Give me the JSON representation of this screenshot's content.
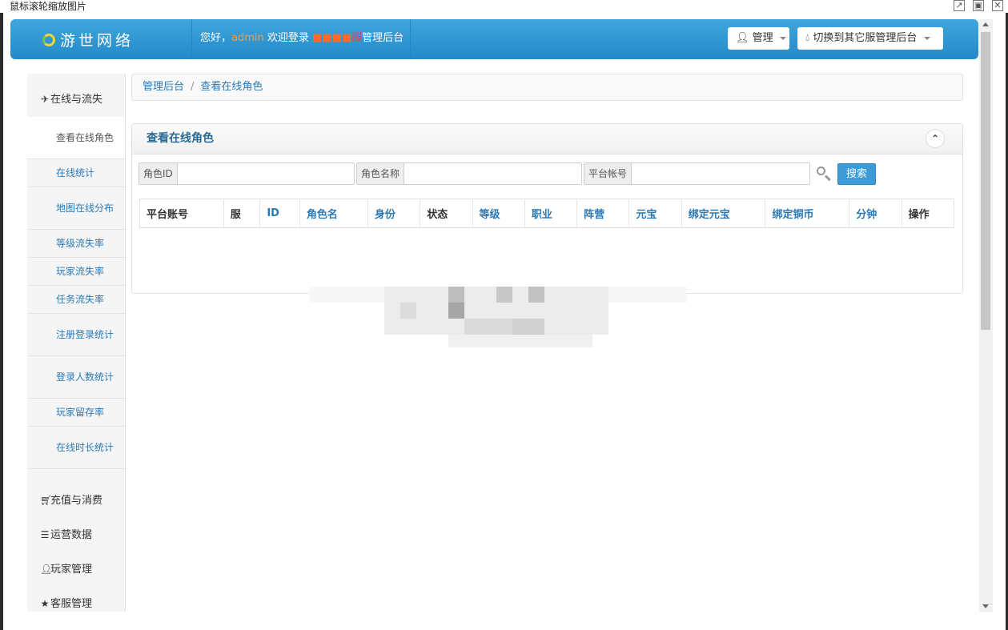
{
  "window": {
    "title": "鼠标滚轮缩放图片"
  },
  "header": {
    "logo": "游世网络",
    "welcome_prefix": "您好，",
    "user": "admin",
    "welcome_mid": " 欢迎登录 ",
    "server_name": "■■■■",
    "server_suffix": "服",
    "welcome_suffix": "管理后台",
    "manage_button": "管理",
    "switch_button": "切换到其它服管理后台"
  },
  "sidebar": {
    "group_online": "在线与流失",
    "items": [
      {
        "label": "查看在线角色"
      },
      {
        "label": "在线统计"
      },
      {
        "label": "地图在线分布"
      },
      {
        "label": "等级流失率"
      },
      {
        "label": "玩家流失率"
      },
      {
        "label": "任务流失率"
      },
      {
        "label": "注册登录统计"
      },
      {
        "label": "登录人数统计"
      },
      {
        "label": "玩家留存率"
      },
      {
        "label": "在线时长统计"
      }
    ],
    "group_recharge": "充值与消费",
    "group_operations": "运营数据",
    "group_players": "玩家管理",
    "group_service": "客服管理"
  },
  "breadcrumb": {
    "home": "管理后台",
    "separator": "/",
    "current": "查看在线角色"
  },
  "panel": {
    "title": "查看在线角色"
  },
  "search": {
    "role_id_label": "角色ID",
    "role_id_value": "",
    "role_name_label": "角色名称",
    "role_name_value": "",
    "account_label": "平台帐号",
    "account_value": "",
    "button": "搜索"
  },
  "table": {
    "columns": [
      {
        "label": "平台账号",
        "sortable": false
      },
      {
        "label": "服",
        "sortable": false
      },
      {
        "label": "ID",
        "sortable": true
      },
      {
        "label": "角色名",
        "sortable": true
      },
      {
        "label": "身份",
        "sortable": true
      },
      {
        "label": "状态",
        "sortable": false
      },
      {
        "label": "等级",
        "sortable": true
      },
      {
        "label": "职业",
        "sortable": true
      },
      {
        "label": "阵营",
        "sortable": true
      },
      {
        "label": "元宝",
        "sortable": true
      },
      {
        "label": "绑定元宝",
        "sortable": true
      },
      {
        "label": "绑定铜币",
        "sortable": true
      },
      {
        "label": "分钟",
        "sortable": true
      },
      {
        "label": "操作",
        "sortable": false
      }
    ],
    "rows": []
  }
}
